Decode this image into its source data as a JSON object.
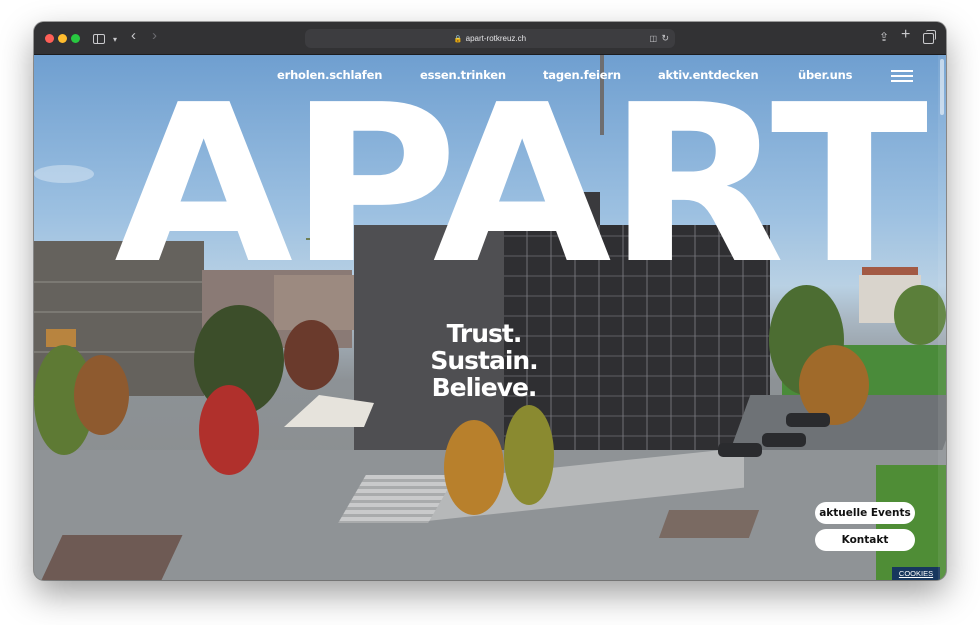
{
  "browser": {
    "url": "apart-rotkreuz.ch",
    "icons": [
      "sidebar-icon",
      "chevron-down-icon",
      "back-icon",
      "forward-icon",
      "lock-icon",
      "translate-icon",
      "reload-icon",
      "share-icon",
      "new-tab-icon",
      "tabs-overview-icon"
    ]
  },
  "nav": {
    "items": [
      "erholen.schlafen",
      "essen.trinken",
      "tagen.feiern",
      "aktiv.entdecken",
      "über.uns"
    ],
    "menu_icon": "hamburger-icon"
  },
  "hero": {
    "logo": "APART",
    "tagline": [
      "Trust.",
      "Sustain.",
      "Believe."
    ]
  },
  "buttons": {
    "events": "aktuelle Events",
    "kontakt": "Kontakt"
  },
  "cookies": "COOKIES",
  "colors": {
    "text": "#ffffff",
    "button_bg": "#ffffff",
    "cookies_bg": "#17375e",
    "browser_chrome": "#323234"
  }
}
